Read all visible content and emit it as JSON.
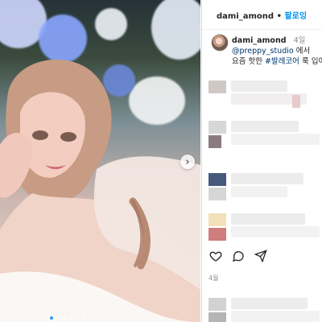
{
  "post": {
    "header": {
      "username": "dami_amond",
      "separator": "•",
      "follow": "팔로잉"
    },
    "caption": {
      "username": "dami_amond",
      "time": "4일",
      "mention": "@preppy_studio",
      "after_mention": " 에서",
      "line2_prefix": "요즘 핫한 ",
      "hashtag": "#발레코어",
      "line2_suffix": " 룩 입어"
    },
    "likes": "4월",
    "actions": [
      "heart-icon",
      "comment-icon",
      "share-icon"
    ],
    "colors": {
      "link": "#00376b",
      "follow": "#0095f6",
      "divider": "#dbdbdb",
      "muted": "#8e8e8e"
    }
  }
}
